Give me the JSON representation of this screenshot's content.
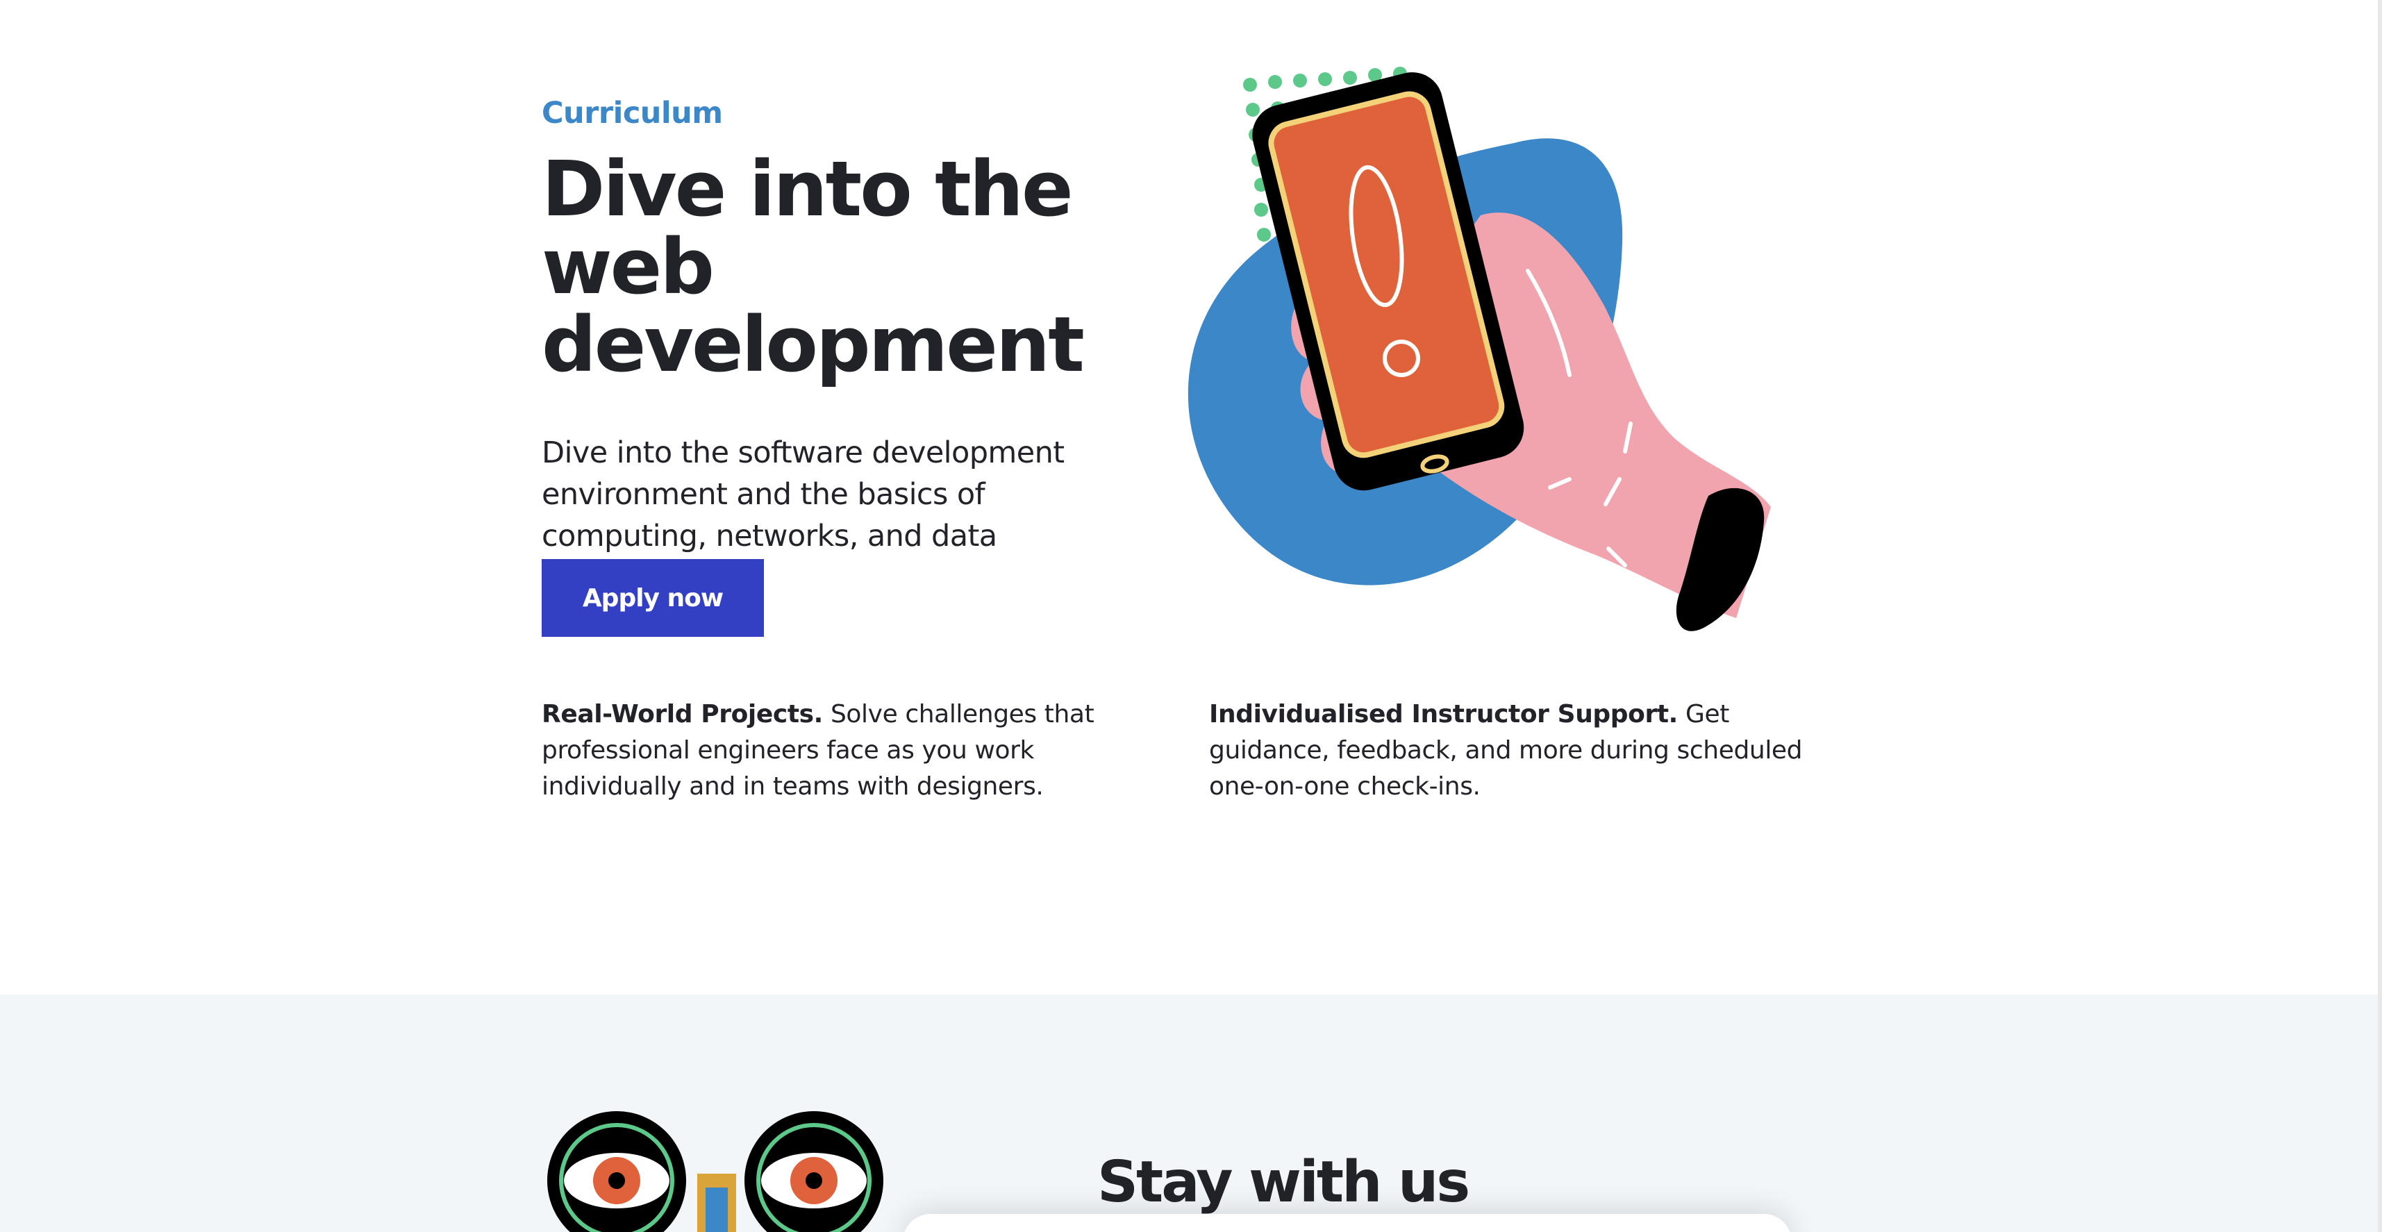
{
  "hero": {
    "eyebrow": "Curriculum",
    "title": "Dive into the web development",
    "lead": "Dive into the software development environment and the basics of computing, networks, and data structures.",
    "cta_label": "Apply now"
  },
  "features": [
    {
      "title": "Real-World Projects.",
      "text": " Solve challenges that professional engineers face as you work individually and in teams with designers."
    },
    {
      "title": "Individualised Instructor Support.",
      "text": " Get guidance, feedback, and more during scheduled one-on-one check-ins."
    }
  ],
  "next_section": {
    "title": "Stay with us"
  },
  "colors": {
    "accent": "#3b87c8",
    "button": "#3440c4",
    "blob": "#3b87c8",
    "phone_screen": "#e0623a",
    "hand": "#f2a4ae",
    "dots": "#5cc98a"
  },
  "icons": {
    "hero_illustration": "hand-holding-phone-alert-icon",
    "section_illustration": "binocular-eyes-icon"
  }
}
